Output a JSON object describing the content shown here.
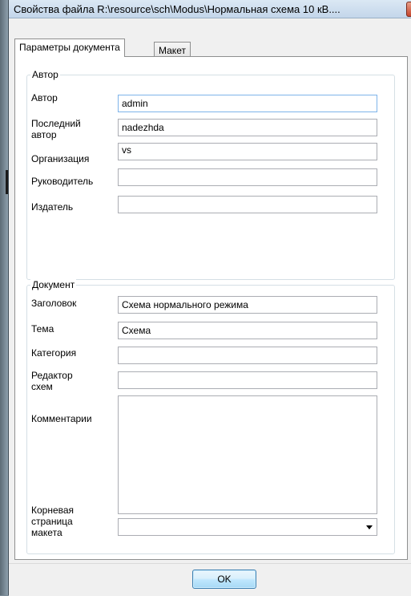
{
  "window": {
    "title": "Свойства файла R:\\resource\\sch\\Modus\\Нормальная схема 10 кВ...."
  },
  "tabs": [
    {
      "label": "Параметры документа",
      "active": true
    },
    {
      "label": "Макет",
      "active": false
    }
  ],
  "author_group": {
    "legend": "Автор",
    "fields": [
      {
        "label": "Автор",
        "value": "admin"
      },
      {
        "label": "Последний\nавтор",
        "value": "nadezhda"
      },
      {
        "label": "Организация",
        "value": "vs"
      },
      {
        "label": "Руководитель",
        "value": ""
      },
      {
        "label": "Издатель",
        "value": ""
      }
    ]
  },
  "document_group": {
    "legend": "Документ",
    "fields": [
      {
        "label": "Заголовок",
        "value": "Схема нормального режима"
      },
      {
        "label": "Тема",
        "value": "Схема"
      },
      {
        "label": "Категория",
        "value": ""
      },
      {
        "label": "Редактор\nсхем",
        "value": ""
      }
    ],
    "comments_label": "Комментарии",
    "comments_value": "",
    "root_page_label": "Корневая\nстраница\nмакета",
    "root_page_value": ""
  },
  "footer": {
    "ok_label": "OK"
  },
  "colors": {
    "title_bg": "#c9dbee",
    "focus_border": "#7eb4ea",
    "ok_border": "#3c7fb1"
  }
}
